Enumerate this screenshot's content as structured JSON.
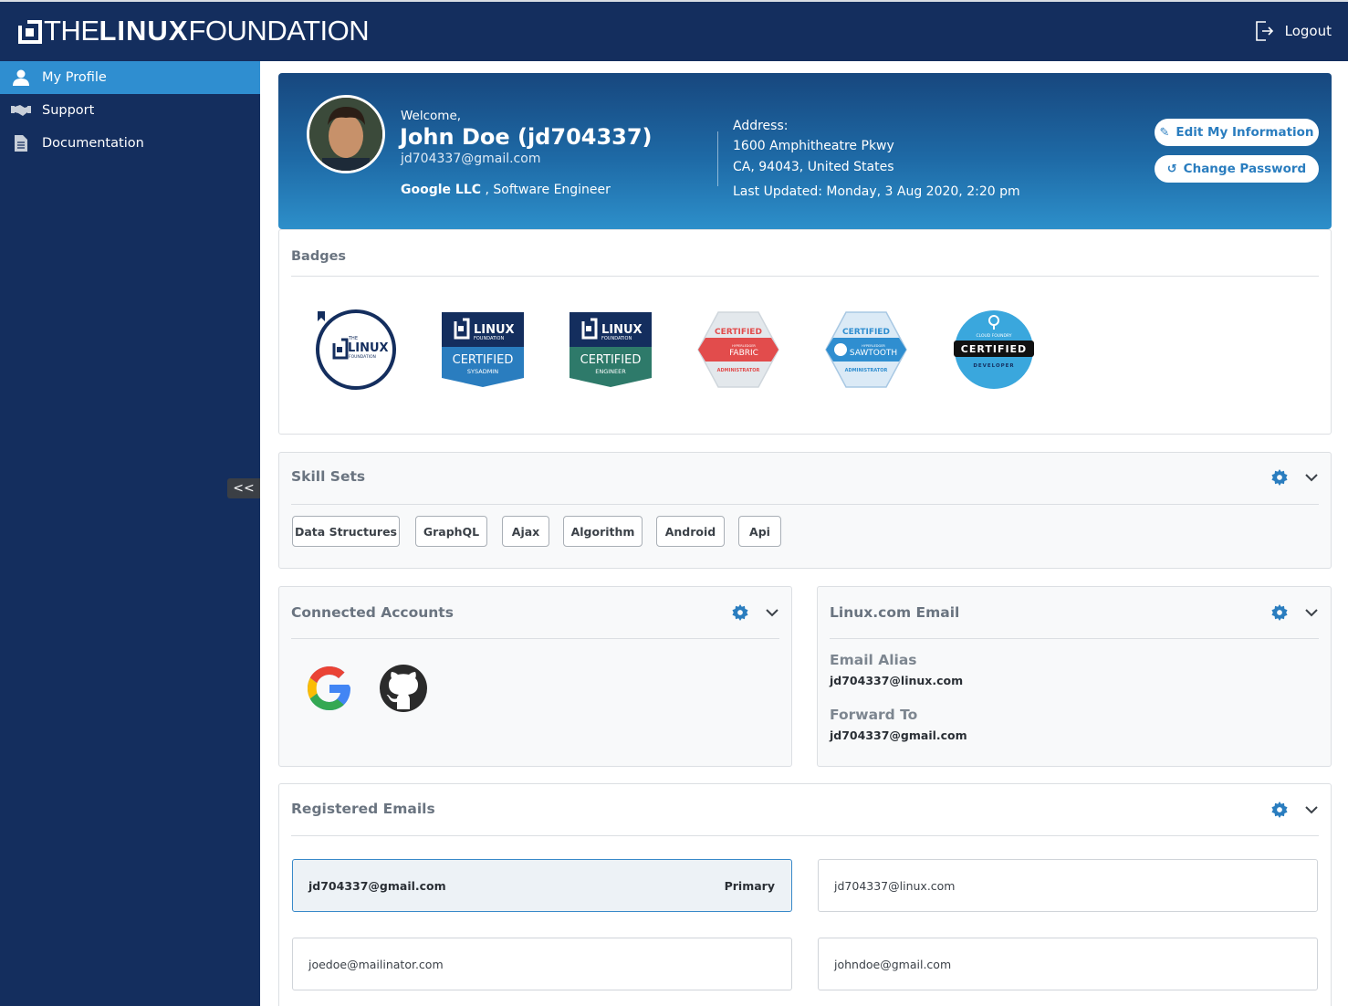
{
  "brand": {
    "logo_thin": "THE",
    "logo_bold": "LINUX",
    "logo_end": "FOUNDATION"
  },
  "header": {
    "logout_label": "Logout"
  },
  "sidebar": {
    "items": [
      {
        "label": "My Profile",
        "icon": "user-icon",
        "active": true
      },
      {
        "label": "Support",
        "icon": "handshake-icon",
        "active": false
      },
      {
        "label": "Documentation",
        "icon": "document-icon",
        "active": false
      }
    ],
    "collapse_label": "<<"
  },
  "profile": {
    "welcome": "Welcome,",
    "name": "John Doe (jd704337)",
    "email": "jd704337@gmail.com",
    "company": "Google LLC",
    "title_sep": " , Software Engineer",
    "address_label": "Address:",
    "address_line1": "1600 Amphitheatre Pkwy",
    "address_line2": "CA, 94043, United States",
    "last_updated": "Last Updated: Monday, 3 Aug 2020, 2:20 pm",
    "edit_button": "Edit My Information",
    "password_button": "Change Password"
  },
  "badges": {
    "title": "Badges",
    "items": [
      {
        "name": "linux-foundation-badge",
        "line1": "THE",
        "line2": "LINUX",
        "line3": "FOUNDATION"
      },
      {
        "name": "certified-sysadmin-badge",
        "top": "LINUX",
        "sub": "FOUNDATION",
        "cert": "CERTIFIED",
        "role": "SYSADMIN",
        "color": "#2a7dbf"
      },
      {
        "name": "certified-engineer-badge",
        "top": "LINUX",
        "sub": "FOUNDATION",
        "cert": "CERTIFIED",
        "role": "ENGINEER",
        "color": "#2e7a6a"
      },
      {
        "name": "hyperledger-fabric-badge",
        "cert": "CERTIFIED",
        "brand": "HYPERLEDGER",
        "product": "FABRIC",
        "role": "ADMINISTRATOR",
        "color": "#e24c4c"
      },
      {
        "name": "hyperledger-sawtooth-badge",
        "cert": "CERTIFIED",
        "brand": "HYPERLEDGER",
        "product": "SAWTOOTH",
        "role": "ADMINISTRATOR",
        "color": "#2f8ed0"
      },
      {
        "name": "cloud-foundry-badge",
        "brand": "CLOUD FOUNDRY",
        "cert": "CERTIFIED",
        "role": "DEVELOPER",
        "color": "#3aa7dd"
      }
    ]
  },
  "skills": {
    "title": "Skill Sets",
    "items": [
      "Data Structures",
      "GraphQL",
      "Ajax",
      "Algorithm",
      "Android",
      "Api"
    ]
  },
  "connected": {
    "title": "Connected Accounts",
    "accounts": [
      "google-icon",
      "github-icon"
    ]
  },
  "linux_email": {
    "title": "Linux.com Email",
    "alias_label": "Email Alias",
    "alias_value": "jd704337@linux.com",
    "forward_label": "Forward To",
    "forward_value": "jd704337@gmail.com"
  },
  "registered": {
    "title": "Registered Emails",
    "primary_tag": "Primary",
    "emails": [
      "jd704337@gmail.com",
      "jd704337@linux.com",
      "joedoe@mailinator.com",
      "johndoe@gmail.com"
    ]
  },
  "colors": {
    "navy": "#142e5e",
    "accent": "#2f8ed0",
    "gear": "#2a7dbf"
  }
}
